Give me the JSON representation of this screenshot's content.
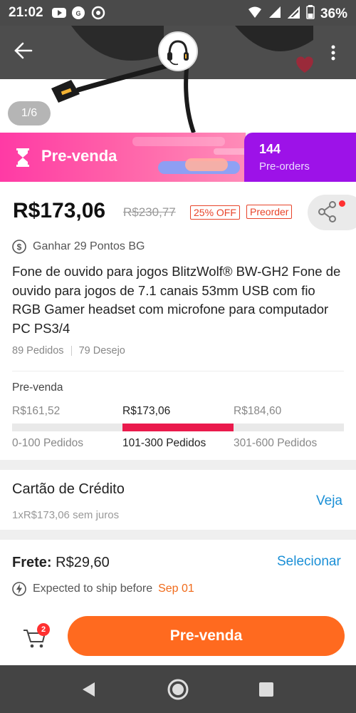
{
  "status_bar": {
    "time": "21:02",
    "battery": "36%"
  },
  "gallery": {
    "page_indicator": "1/6"
  },
  "banner": {
    "title": "Pre-venda",
    "preorders_count": "144",
    "preorders_label": "Pre-orders"
  },
  "price": {
    "current": "R$173,06",
    "original": "R$230,77",
    "discount": "25% OFF",
    "preorder_tag": "Preorder"
  },
  "points": {
    "text": "Ganhar 29 Pontos BG"
  },
  "product": {
    "title": "Fone de ouvido para jogos BlitzWolf® BW-GH2 Fone de ouvido para jogos de 7.1 canais 53mm USB com fio RGB Gamer headset com microfone para computador PC PS3/4",
    "orders": "89 Pedidos",
    "wishes": "79 Desejo"
  },
  "tiers": {
    "heading": "Pre-venda",
    "items": [
      {
        "price": "R$161,52",
        "range": "0-100 Pedidos"
      },
      {
        "price": "R$173,06",
        "range": "101-300 Pedidos"
      },
      {
        "price": "R$184,60",
        "range": "301-600 Pedidos"
      }
    ],
    "active_index": 1
  },
  "payment": {
    "title": "Cartão de Crédito",
    "installments": "1xR$173,06 sem juros",
    "link": "Veja"
  },
  "shipping": {
    "label": "Frete:",
    "value": "R$29,60",
    "select_link": "Selecionar",
    "expected_text": "Expected to ship before",
    "expected_date": "Sep 01"
  },
  "action_bar": {
    "cart_count": "2",
    "buy_label": "Pre-venda"
  },
  "colors": {
    "accent": "#ff6a1f",
    "tier_active": "#ea1a4c",
    "link": "#1a8fd6",
    "banner_pink": "#ff3aa5",
    "banner_purple": "#9d12e8"
  },
  "icons": [
    "back-arrow-icon",
    "heart-icon",
    "more-vertical-icon",
    "hourglass-icon",
    "share-icon",
    "coin-icon",
    "lightning-icon",
    "cart-icon",
    "nav-back-icon",
    "nav-home-icon",
    "nav-recents-icon"
  ]
}
